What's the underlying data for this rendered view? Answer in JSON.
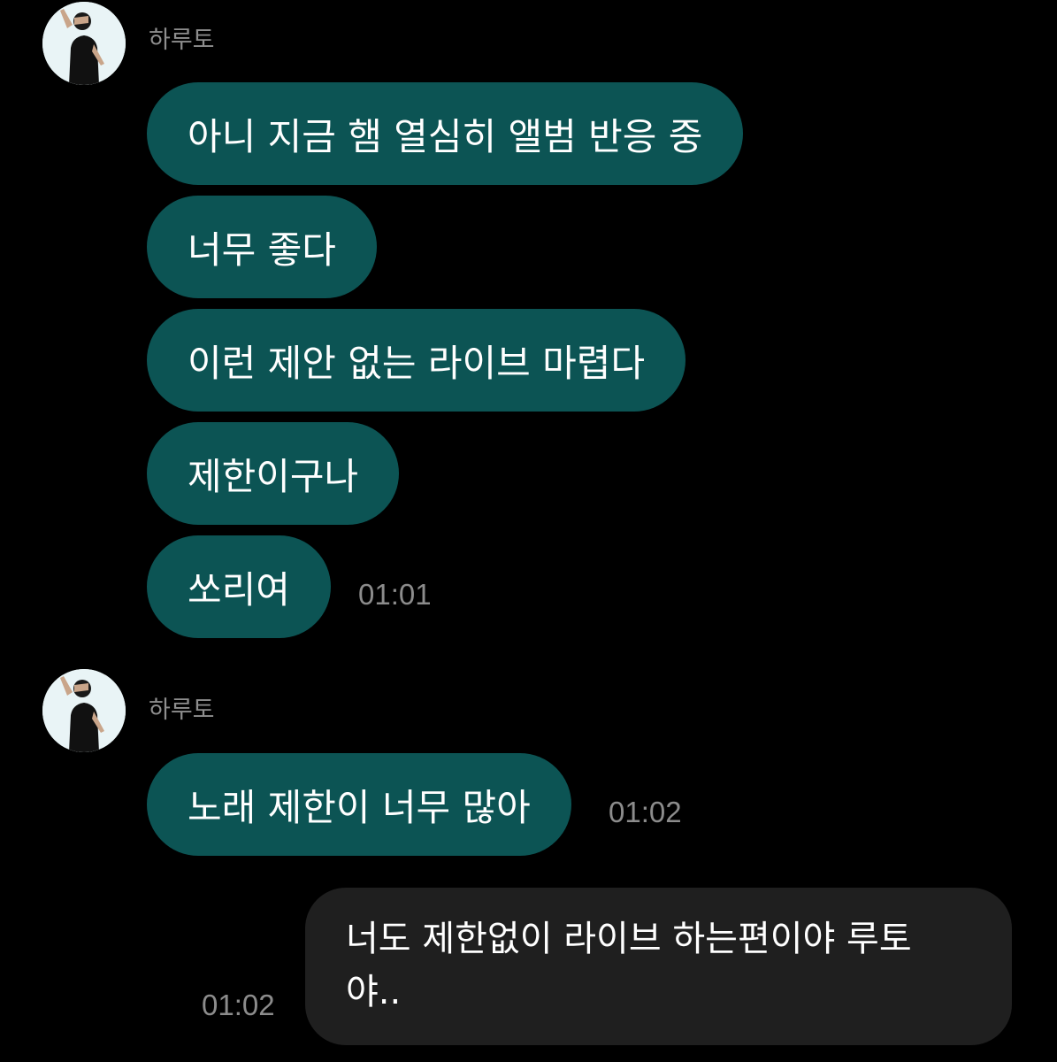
{
  "conversation": {
    "groups": [
      {
        "sender": "하루토",
        "avatar_icon": "profile-photo",
        "messages": [
          "아니 지금 햄 열심히 앨범 반응 중",
          "너무 좋다",
          "이런 제안 없는 라이브 마렵다",
          "제한이구나",
          "쏘리여"
        ],
        "time": "01:01"
      },
      {
        "sender": "하루토",
        "avatar_icon": "profile-photo",
        "messages": [
          "노래 제한이 너무 많아"
        ],
        "time": "01:02"
      }
    ],
    "outgoing": {
      "lines": [
        "너도 제한없이 라이브 하는편이야 루토",
        "야.."
      ],
      "time": "01:02"
    }
  },
  "colors": {
    "background": "#000000",
    "incoming_bubble": "#0c5454",
    "outgoing_bubble": "#1f1f1f",
    "timestamp": "#8c8c8c"
  }
}
